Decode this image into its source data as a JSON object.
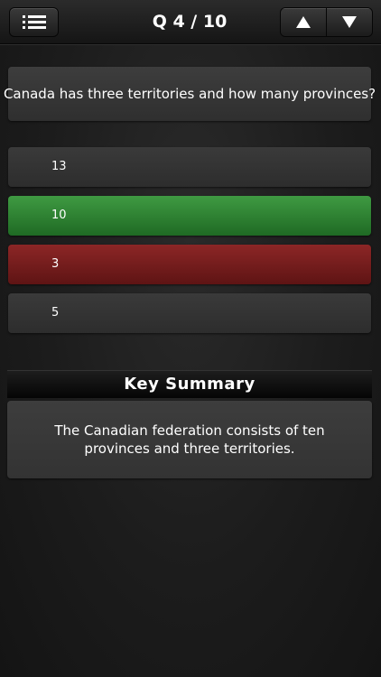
{
  "header": {
    "title": "Q 4 / 10",
    "menu_icon": "list-icon",
    "prev_icon": "triangle-up-icon",
    "next_icon": "triangle-down-icon"
  },
  "question": {
    "text": "Canada has three territories and how many provinces?"
  },
  "answers": [
    {
      "label": "13",
      "state": "neutral"
    },
    {
      "label": "10",
      "state": "correct"
    },
    {
      "label": "3",
      "state": "wrong"
    },
    {
      "label": "5",
      "state": "neutral"
    }
  ],
  "summary": {
    "title": "Key Summary",
    "text": "The Canadian federation consists of ten provinces and three territories."
  },
  "colors": {
    "correct": "#2e8a34",
    "wrong": "#7a1e1e",
    "neutral": "#353535"
  }
}
